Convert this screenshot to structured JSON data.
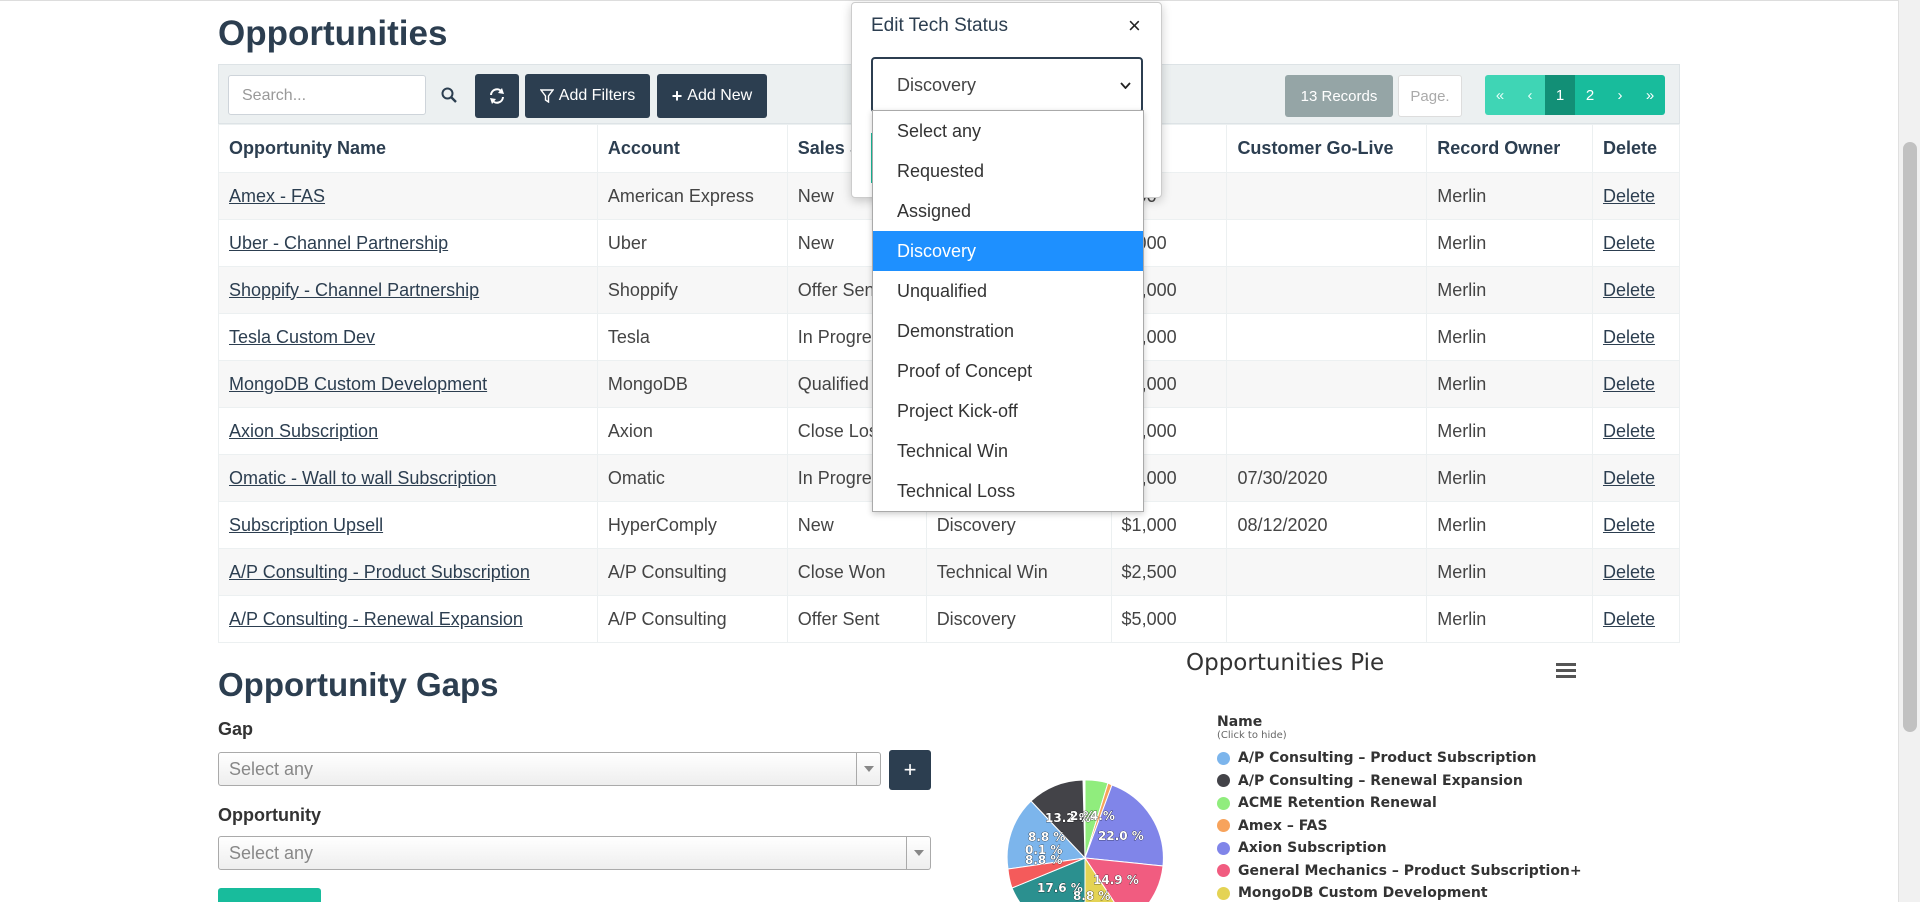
{
  "page": {
    "title": "Opportunities"
  },
  "toolbar": {
    "search_placeholder": "Search...",
    "add_filters_label": "Add Filters",
    "add_new_label": "Add New",
    "records_label": "13 Records",
    "page_placeholder": "Page.",
    "pager": [
      "«",
      "‹",
      "1",
      "2",
      "›",
      "»"
    ]
  },
  "table": {
    "headers": [
      "Opportunity Name",
      "Account",
      "Sales S",
      "",
      "unt",
      "Customer Go-Live",
      "Record Owner",
      "Delete"
    ],
    "rows": [
      {
        "name": "Amex - FAS",
        "account": "American Express",
        "sales": "New",
        "tech": "",
        "amount": ",000",
        "golive": "",
        "owner": "Merlin",
        "delete": "Delete"
      },
      {
        "name": "Uber - Channel Partnership",
        "account": "Uber",
        "sales": "New",
        "tech": "",
        "amount": "0,000",
        "golive": "",
        "owner": "Merlin",
        "delete": "Delete"
      },
      {
        "name": "Shoppify - Channel Partnership",
        "account": "Shoppify",
        "sales": "Offer Sen",
        "tech": "",
        "amount": "00,000",
        "golive": "",
        "owner": "Merlin",
        "delete": "Delete"
      },
      {
        "name": "Tesla Custom Dev",
        "account": "Tesla",
        "sales": "In Progre",
        "tech": "",
        "amount": "00,000",
        "golive": "",
        "owner": "Merlin",
        "delete": "Delete"
      },
      {
        "name": "MongoDB Custom Development",
        "account": "MongoDB",
        "sales": "Qualified",
        "tech": "",
        "amount": "00,000",
        "golive": "",
        "owner": "Merlin",
        "delete": "Delete"
      },
      {
        "name": "Axion Subscription",
        "account": "Axion",
        "sales": "Close Los",
        "tech": "",
        "amount": "50,000",
        "golive": "",
        "owner": "Merlin",
        "delete": "Delete"
      },
      {
        "name": "Omatic - Wall to wall Subscription",
        "account": "Omatic",
        "sales": "In Progre",
        "tech": "",
        "amount": "00,000",
        "golive": "07/30/2020",
        "owner": "Merlin",
        "delete": "Delete"
      },
      {
        "name": "Subscription Upsell",
        "account": "HyperComply",
        "sales": "New",
        "tech": "Discovery",
        "amount": "$1,000",
        "golive": "08/12/2020",
        "owner": "Merlin",
        "delete": "Delete"
      },
      {
        "name": "A/P Consulting - Product Subscription",
        "account": "A/P Consulting",
        "sales": "Close Won",
        "tech": "Technical Win",
        "amount": "$2,500",
        "golive": "",
        "owner": "Merlin",
        "delete": "Delete"
      },
      {
        "name": "A/P Consulting - Renewal Expansion",
        "account": "A/P Consulting",
        "sales": "Offer Sent",
        "tech": "Discovery",
        "amount": "$5,000",
        "golive": "",
        "owner": "Merlin",
        "delete": "Delete"
      }
    ]
  },
  "gaps": {
    "title": "Opportunity Gaps",
    "gap_label": "Gap",
    "gap_placeholder": "Select any",
    "opportunity_label": "Opportunity",
    "opportunity_placeholder": "Select any"
  },
  "pie": {
    "title": "Opportunities Pie",
    "legend_title": "Name",
    "legend_hint": "(Click to hide)",
    "legend": [
      {
        "name": "A/P Consulting – Product Subscription",
        "color": "#7cb5ec"
      },
      {
        "name": "A/P Consulting – Renewal Expansion",
        "color": "#434348"
      },
      {
        "name": "ACME Retention Renewal",
        "color": "#90ed7d"
      },
      {
        "name": "Amex – FAS",
        "color": "#f7a35c"
      },
      {
        "name": "Axion Subscription",
        "color": "#8085e9"
      },
      {
        "name": "General Mechanics – Product Subscription+",
        "color": "#f15c80"
      },
      {
        "name": "MongoDB Custom Development",
        "color": "#e4d354"
      }
    ],
    "labels": [
      "13.2 %",
      "2.%",
      "4.%",
      "22.0 %",
      "14.9 %",
      "8.8 %",
      "17.6 %",
      "8.8 %",
      "0.1 %",
      "8.8 %"
    ]
  },
  "modal": {
    "title": "Edit Tech Status",
    "close": "×",
    "selected": "Discovery",
    "options": [
      "Select any",
      "Requested",
      "Assigned",
      "Discovery",
      "Unqualified",
      "Demonstration",
      "Proof of Concept",
      "Project Kick-off",
      "Technical Win",
      "Technical Loss"
    ],
    "selected_index": 3
  }
}
